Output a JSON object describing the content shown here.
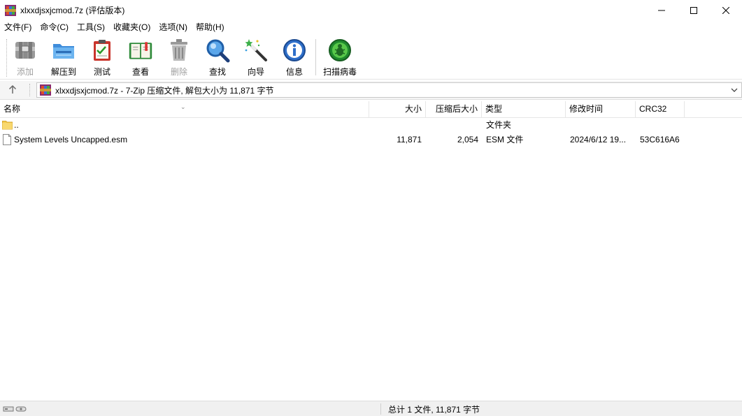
{
  "window": {
    "title": "xlxxdjsxjcmod.7z (评估版本)",
    "controls": [
      "minimize-icon",
      "maximize-icon",
      "close-icon"
    ]
  },
  "menu": [
    {
      "label": "文件(F)"
    },
    {
      "label": "命令(C)"
    },
    {
      "label": "工具(S)"
    },
    {
      "label": "收藏夹(O)"
    },
    {
      "label": "选项(N)"
    },
    {
      "label": "帮助(H)"
    }
  ],
  "toolbar": {
    "buttons": [
      {
        "label": "添加",
        "icon": "add-archive-icon",
        "disabled": true
      },
      {
        "label": "解压到",
        "icon": "extract-folder-icon",
        "disabled": false
      },
      {
        "label": "测试",
        "icon": "test-clipboard-icon",
        "disabled": false
      },
      {
        "label": "查看",
        "icon": "view-book-icon",
        "disabled": false
      },
      {
        "label": "删除",
        "icon": "delete-trash-icon",
        "disabled": true
      },
      {
        "label": "查找",
        "icon": "find-magnifier-icon",
        "disabled": false
      },
      {
        "label": "向导",
        "icon": "wizard-wand-icon",
        "disabled": false
      },
      {
        "label": "信息",
        "icon": "info-icon",
        "disabled": false
      },
      {
        "label": "扫描病毒",
        "icon": "virus-scan-icon",
        "disabled": false
      }
    ]
  },
  "address": {
    "text": "xlxxdjsxjcmod.7z - 7-Zip 压缩文件, 解包大小为 11,871 字节"
  },
  "list": {
    "columns": [
      {
        "key": "name",
        "label": "名称"
      },
      {
        "key": "size",
        "label": "大小"
      },
      {
        "key": "packed",
        "label": "压缩后大小"
      },
      {
        "key": "type",
        "label": "类型"
      },
      {
        "key": "modified",
        "label": "修改时间"
      },
      {
        "key": "crc",
        "label": "CRC32"
      }
    ],
    "rows": [
      {
        "name": "..",
        "size": "",
        "packed": "",
        "type": "文件夹",
        "modified": "",
        "crc": "",
        "icon": "folder-icon"
      },
      {
        "name": "System Levels Uncapped.esm",
        "size": "11,871",
        "packed": "2,054",
        "type": "ESM 文件",
        "modified": "2024/6/12 19...",
        "crc": "53C616A6",
        "icon": "file-icon"
      }
    ]
  },
  "status": {
    "text": "总计 1 文件, 11,871 字节"
  }
}
